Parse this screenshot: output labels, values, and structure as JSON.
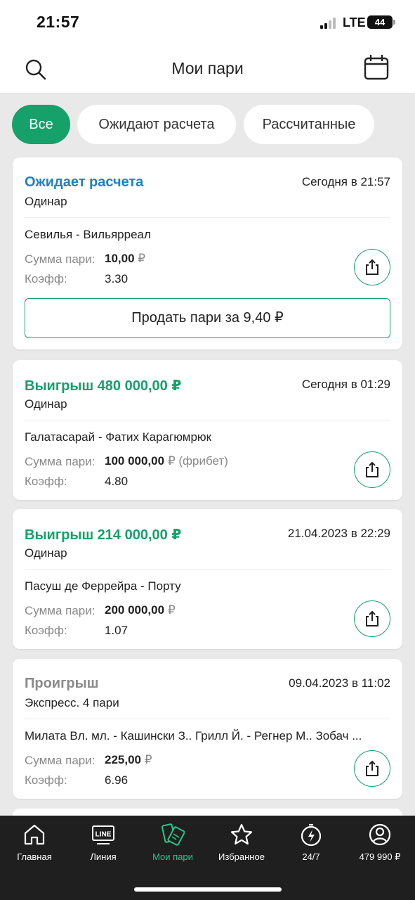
{
  "status_bar": {
    "time": "21:57",
    "network": "LTE",
    "battery": "44"
  },
  "header": {
    "title": "Мои пари"
  },
  "filters": [
    "Все",
    "Ожидают расчета",
    "Рассчитанные"
  ],
  "bets": [
    {
      "status": "Ожидает расчета",
      "status_color": "#1f82c0",
      "date": "Сегодня в 21:57",
      "type": "Одинар",
      "event": "Севилья - Вильярреал",
      "sum_label": "Сумма пари:",
      "sum_amount": "10,00",
      "currency": "₽",
      "sum_note": "",
      "coef_label": "Коэфф:",
      "coef": "3.30",
      "sell_label": "Продать пари за 9,40 ₽"
    },
    {
      "status": "Выигрыш 480 000,00  ₽",
      "status_color": "#16a06a",
      "date": "Сегодня в 01:29",
      "type": "Одинар",
      "event": "Галатасарай - Фатих Карагюмрюк",
      "sum_label": "Сумма пари:",
      "sum_amount": "100 000,00",
      "currency": "₽",
      "sum_note": "(фрибет)",
      "coef_label": "Коэфф:",
      "coef": "4.80"
    },
    {
      "status": "Выигрыш 214 000,00  ₽",
      "status_color": "#16a06a",
      "date": "21.04.2023 в 22:29",
      "type": "Одинар",
      "event": "Пасуш де Феррейра - Порту",
      "sum_label": "Сумма пари:",
      "sum_amount": "200 000,00",
      "currency": "₽",
      "sum_note": "",
      "coef_label": "Коэфф:",
      "coef": "1.07"
    },
    {
      "status": "Проигрыш",
      "status_color": "#8a8a8a",
      "date": "09.04.2023 в 11:02",
      "type": "Экспресс. 4 пари",
      "event": "Милата Вл. мл. - Кашински З.. Грилл Й. - Регнер М.. Зобач ...",
      "sum_label": "Сумма пари:",
      "sum_amount": "225,00",
      "currency": "₽",
      "sum_note": "",
      "coef_label": "Коэфф:",
      "coef": "6.96"
    }
  ],
  "bottom_nav": [
    {
      "label": "Главная",
      "icon": "home-icon"
    },
    {
      "label": "Линия",
      "icon": "line-icon",
      "badge": "LINE"
    },
    {
      "label": "Мои пари",
      "icon": "tickets-icon",
      "active": true
    },
    {
      "label": "Избранное",
      "icon": "star-icon"
    },
    {
      "label": "24/7",
      "icon": "stopwatch-icon"
    },
    {
      "label": "479 990 ₽",
      "icon": "profile-icon"
    }
  ]
}
